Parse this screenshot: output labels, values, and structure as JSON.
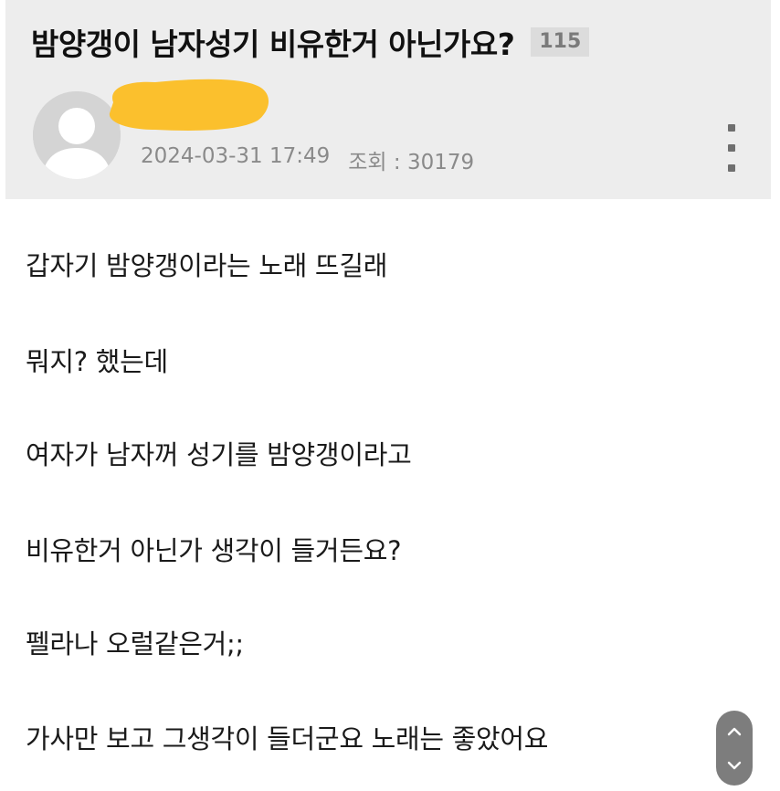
{
  "post": {
    "title": "밤양갱이 남자성기 비유한거 아닌가요?",
    "comment_count": "115",
    "date": "2024-03-31 17:49",
    "views": "조회 : 30179",
    "mask_color": "#fbc02d"
  },
  "body_lines": [
    "갑자기 밤양갱이라는 노래 뜨길래",
    "뭐지? 했는데",
    "여자가 남자꺼 성기를 밤양갱이라고",
    "비유한거 아닌가 생각이 들거든요?",
    "펠라나 오럴같은거;;",
    "가사만 보고 그생각이 들더군요 노래는 좋았어요"
  ],
  "icons": {
    "avatar": "default-user-icon",
    "more": "more-vertical-icon",
    "scroll_up": "chevron-up-icon",
    "scroll_down": "chevron-down-icon"
  }
}
